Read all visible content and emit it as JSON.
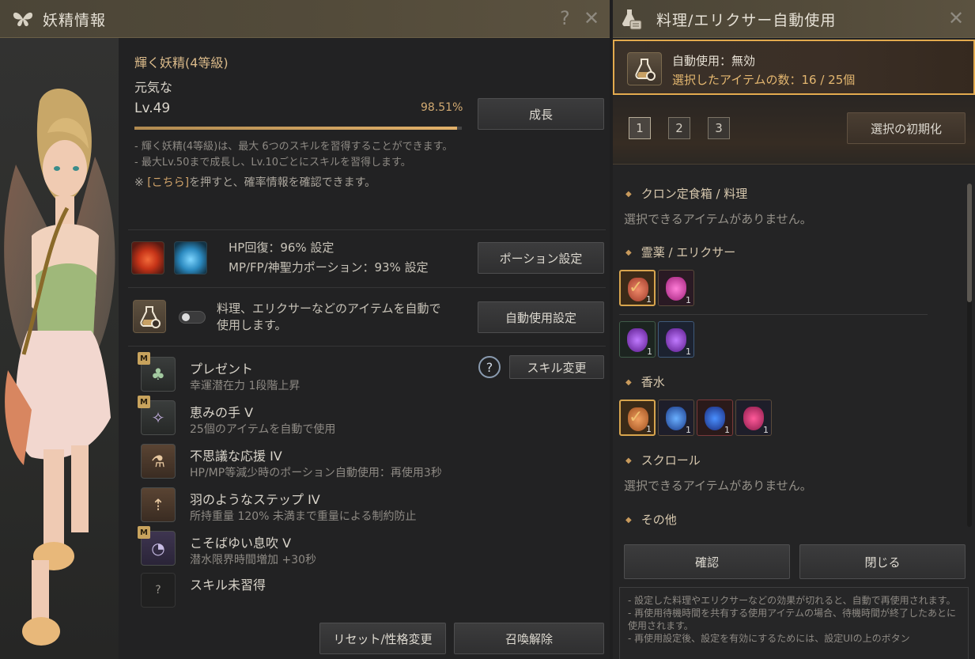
{
  "left": {
    "title": "妖精情報",
    "help": "?",
    "close": "✕",
    "fairy": {
      "name": "輝く妖精(4等級)",
      "trait": "元気な",
      "level": "Lv.49",
      "exp_text": "98.51%",
      "exp_fraction": 0.9851,
      "grow_button": "成長",
      "desc_lines": [
        "- 輝く妖精(4等級)は、最大 6つのスキルを習得することができます。",
        "- 最大Lv.50まで成長し、Lv.10ごとにスキルを習得します。"
      ],
      "note_prefix": "※ ",
      "note_link": "[こちら]",
      "note_suffix": "を押すと、確率情報を確認できます。"
    },
    "potion": {
      "hp_text": "HP回復：96% 設定",
      "mp_text": "MP/FP/神聖力ポーション：93% 設定",
      "button": "ポーション設定"
    },
    "auto": {
      "text_line1": "料理、エリクサーなどのアイテムを自動で",
      "text_line2": "使用します。",
      "button": "自動使用設定"
    },
    "skills": [
      {
        "name": "プレゼント",
        "desc": "幸運潜在力 1段階上昇",
        "badge": "M",
        "icon": "clover-icon"
      },
      {
        "name": "恵みの手 V",
        "desc": "25個のアイテムを自動で使用",
        "badge": "M",
        "icon": "fairy-hand-icon"
      },
      {
        "name": "不思議な応援 IV",
        "desc": "HP/MP等減少時のポーション自動使用：再使用3秒",
        "badge": "",
        "icon": "potion-plus-icon"
      },
      {
        "name": "羽のようなステップ IV",
        "desc": "所持重量 120% 未満まで重量による制約防止",
        "badge": "",
        "icon": "weight-icon"
      },
      {
        "name": "こそばゆい息吹 V",
        "desc": "潜水限界時間増加 +30秒",
        "badge": "M",
        "icon": "bubble-timer-icon"
      },
      {
        "name": "スキル未習得",
        "desc": "",
        "badge": "",
        "icon": "unknown-icon"
      }
    ],
    "skill_help": "?",
    "skill_change_button": "スキル変更",
    "badge_letter": "M",
    "unknown_mark": "?",
    "reset_button": "リセット/性格変更",
    "dismiss_button": "召喚解除"
  },
  "right": {
    "title": "料理/エリクサー自動使用",
    "close": "✕",
    "status_line1": "自動使用：無効",
    "status_line2": "選択したアイテムの数：16 / 25個",
    "preset_tabs": [
      "1",
      "2",
      "3"
    ],
    "reset_selection_button": "選択の初期化",
    "categories": {
      "cooking": {
        "title": "クロン定食箱 / 料理",
        "empty": "選択できるアイテムがありません。"
      },
      "elixir": {
        "title": "霊薬 / エリクサー"
      },
      "perfume": {
        "title": "香水"
      },
      "scroll": {
        "title": "スクロール",
        "empty": "選択できるアイテムがありません。"
      },
      "other": {
        "title": "その他"
      }
    },
    "slot_qty": "1",
    "confirm_button": "確認",
    "close_button": "閉じる",
    "notes": [
      "- 設定した料理やエリクサーなどの効果が切れると、自動で再使用されます。",
      "- 再使用待機時間を共有する使用アイテムの場合、待機時間が終了したあとに使用されます。",
      "- 再使用設定後、設定を有効にするためには、設定UIの上のボタン"
    ]
  },
  "colors": {
    "accent_gold": "#e3aa4e",
    "exp_bar": "#d6a860"
  }
}
